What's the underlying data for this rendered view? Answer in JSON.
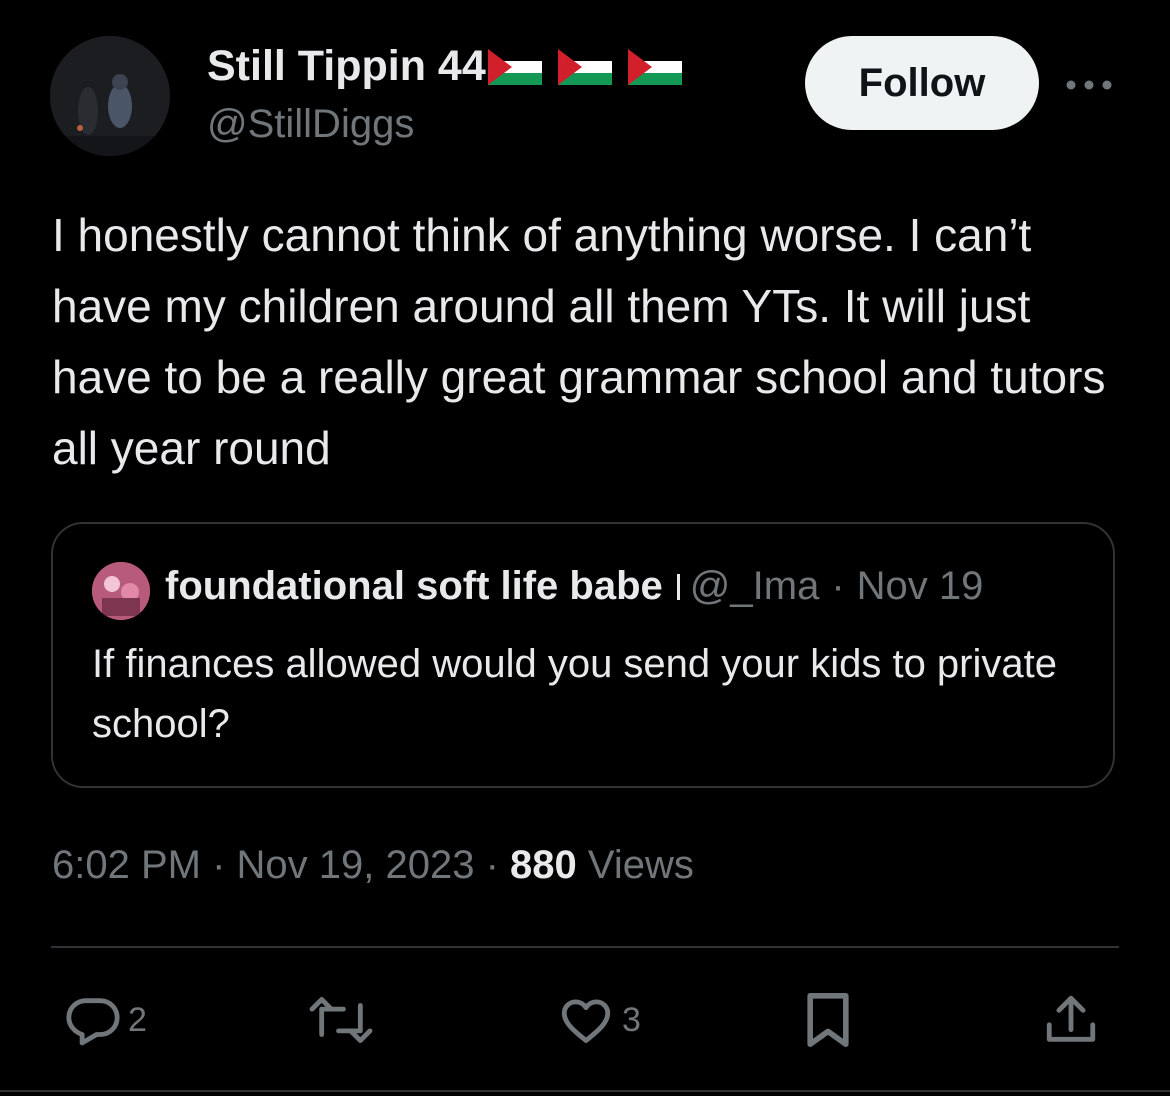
{
  "author": {
    "display_name": "Still Tippin 44",
    "handle": "@StillDiggs",
    "name_emoji": [
      "palestine-flag",
      "palestine-flag",
      "palestine-flag"
    ]
  },
  "follow_label": "Follow",
  "tweet": {
    "text": "I honestly cannot think of anything worse. I can’t have my children around all them YTs. It will just have to be a really great grammar school and tutors all year round"
  },
  "quote": {
    "name": "foundational soft life babe",
    "handle": "@_Ima",
    "separator": "·",
    "date": "Nov 19",
    "text": "If finances allowed would you send your kids to private school?"
  },
  "meta": {
    "time": "6:02 PM",
    "separator": "·",
    "date": "Nov 19, 2023",
    "views_count": "880",
    "views_label": "Views"
  },
  "actions": {
    "reply_count": "2",
    "like_count": "3"
  },
  "colors": {
    "background": "#000000",
    "text_primary": "#e7e9ea",
    "text_secondary": "#71767b",
    "border": "#2f3336",
    "follow_bg": "#eff3f4",
    "flag_red": "#d21f2c",
    "flag_green": "#149954"
  }
}
